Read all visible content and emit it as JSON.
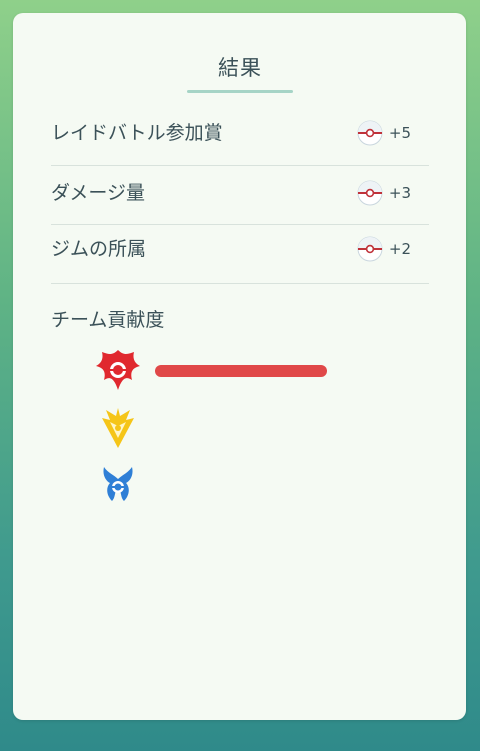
{
  "results": {
    "title": "結果",
    "rows": [
      {
        "label": "レイドバトル参加賞",
        "amount": "+5",
        "icon": "premier-ball-icon"
      },
      {
        "label": "ダメージ量",
        "amount": "+3",
        "icon": "premier-ball-icon"
      },
      {
        "label": "ジムの所属",
        "amount": "+2",
        "icon": "premier-ball-icon"
      }
    ],
    "team_section": {
      "title": "チーム貢献度",
      "teams": [
        {
          "name": "valor",
          "icon": "valor-team-icon",
          "color": "#e04848",
          "contribution_fraction": 1.0
        },
        {
          "name": "instinct",
          "icon": "instinct-team-icon",
          "color": "#f5c518",
          "contribution_fraction": 0
        },
        {
          "name": "mystic",
          "icon": "mystic-team-icon",
          "color": "#2f7fd6",
          "contribution_fraction": 0
        }
      ]
    }
  }
}
